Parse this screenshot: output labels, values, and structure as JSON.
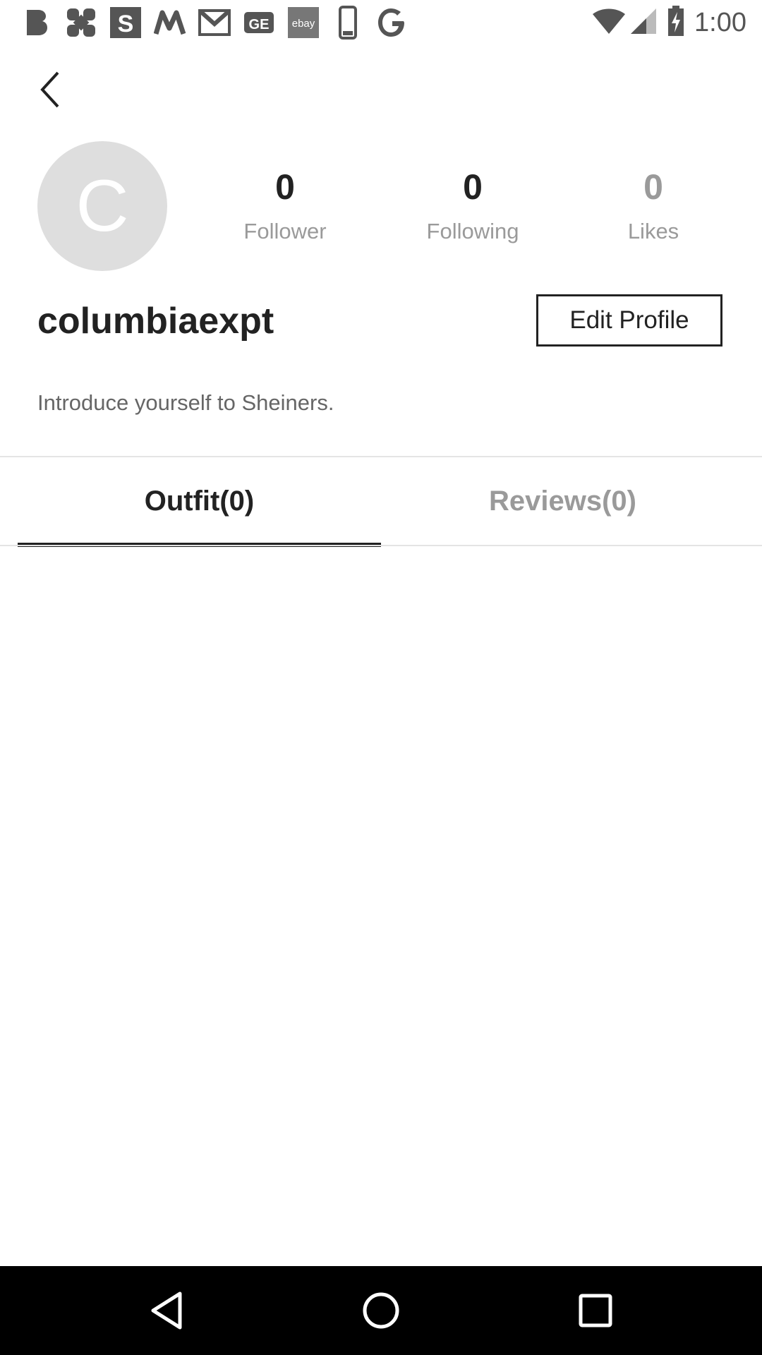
{
  "status_bar": {
    "time": "1:00",
    "icons": [
      "b-app-icon",
      "puzzle-app-icon",
      "s-app-icon",
      "m-app-icon",
      "gmail-icon",
      "ge-app-icon",
      "ebay-icon",
      "phone-icon",
      "google-icon"
    ],
    "ebay_text": "ebay",
    "ge_text": "GE"
  },
  "profile": {
    "avatar_letter": "C",
    "username": "columbiaexpt",
    "edit_button_label": "Edit Profile",
    "bio_placeholder": "Introduce yourself to Sheiners.",
    "stats": [
      {
        "value": "0",
        "label": "Follower"
      },
      {
        "value": "0",
        "label": "Following"
      },
      {
        "value": "0",
        "label": "Likes"
      }
    ]
  },
  "tabs": [
    {
      "label": "Outfit(0)",
      "active": true
    },
    {
      "label": "Reviews(0)",
      "active": false
    }
  ],
  "colors": {
    "text_primary": "#222222",
    "text_secondary": "#9a9a9a",
    "avatar_bg": "#dedede",
    "nav_bar": "#000000"
  }
}
